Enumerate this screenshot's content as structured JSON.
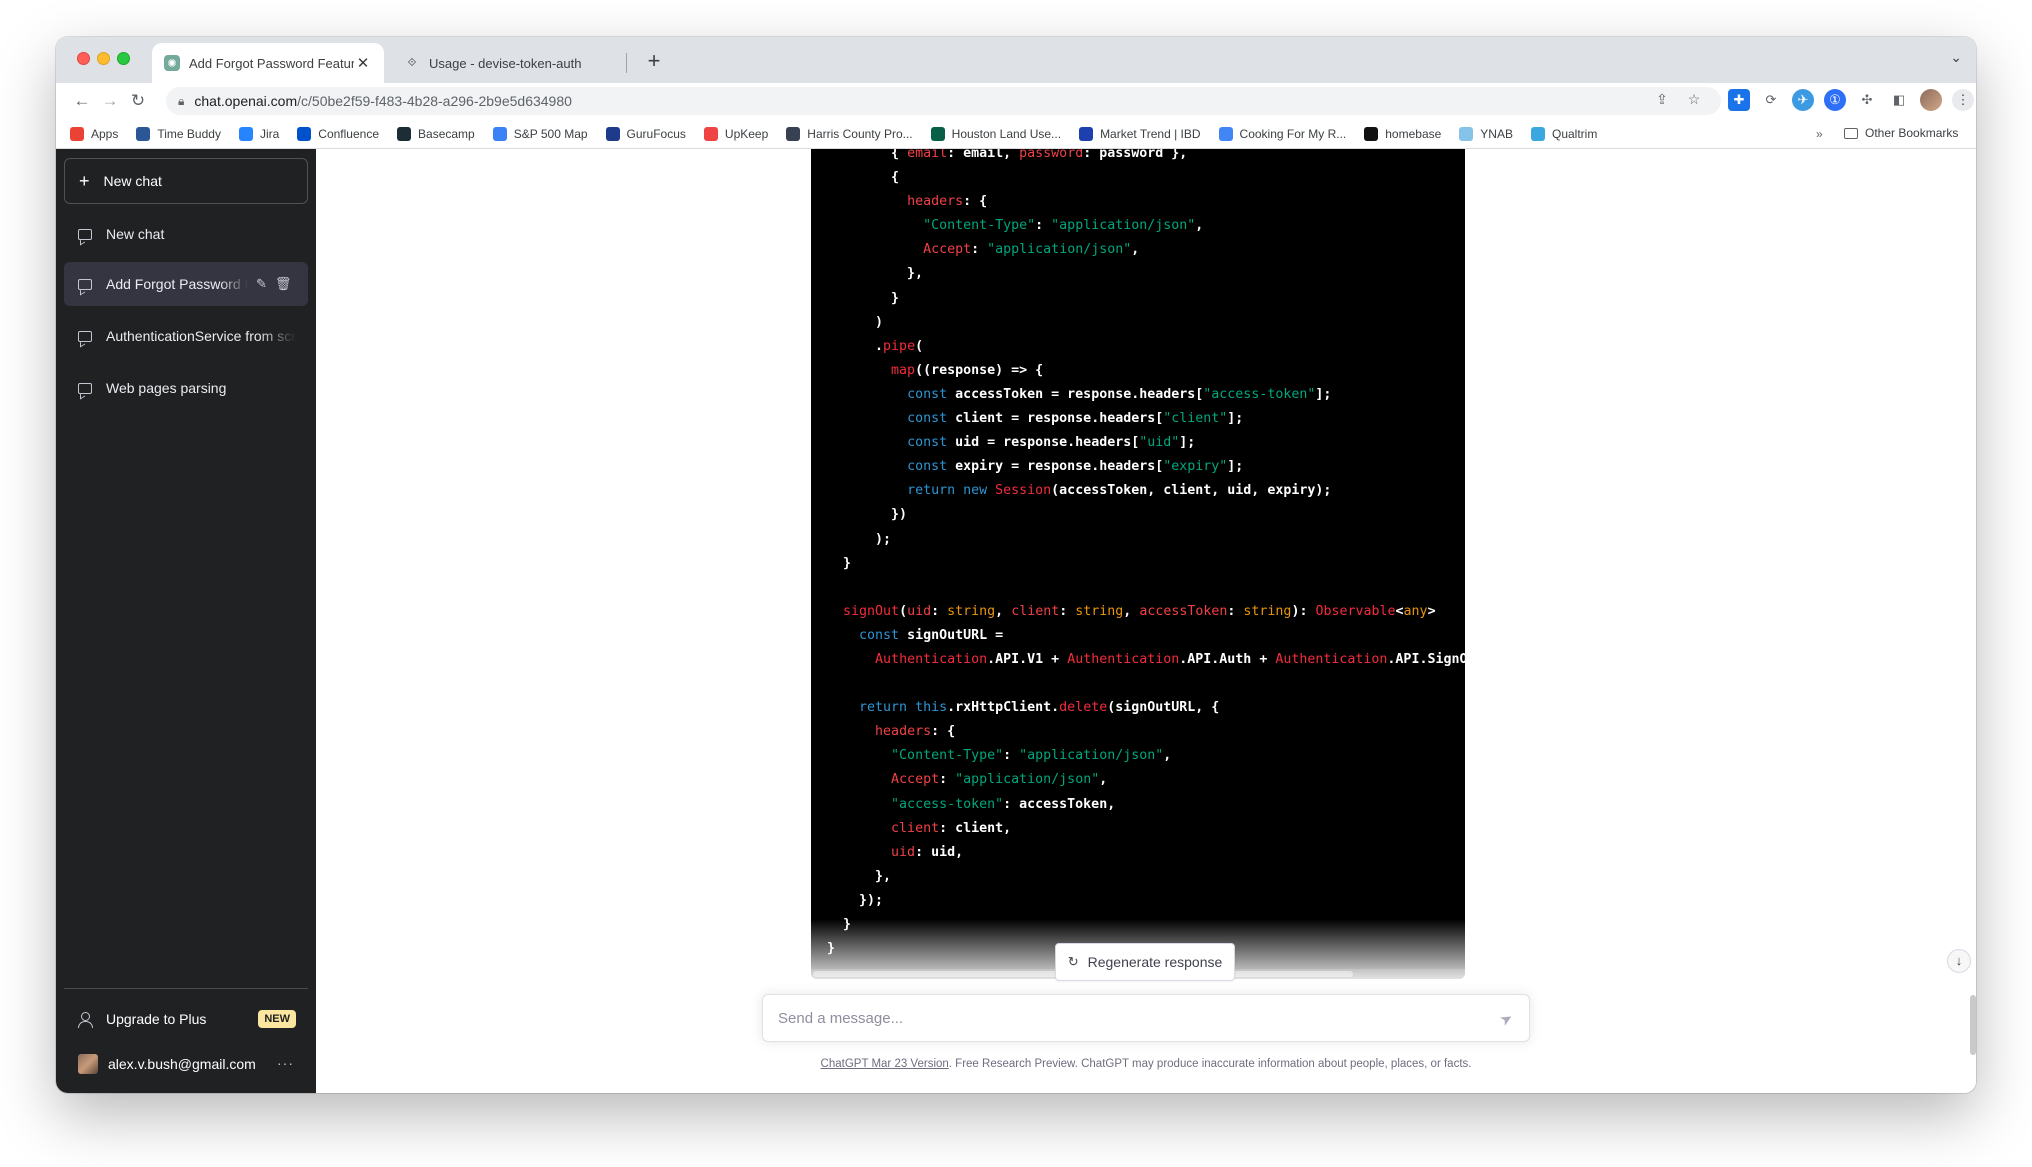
{
  "browser": {
    "tabs": [
      {
        "title": "Add Forgot Password Feature & ...",
        "favicon": "openai-logo-icon",
        "active": true
      },
      {
        "title": "Usage - devise-token-auth",
        "favicon": "devise-icon",
        "active": false
      }
    ],
    "url_host": "chat.openai.com",
    "url_path": "/c/50be2f59-f483-4b28-a296-2b9e5d634980",
    "bookmarks": [
      {
        "label": "Apps",
        "icon": "apps-grid-icon",
        "color": "#ea4335"
      },
      {
        "label": "Time Buddy",
        "icon": "time-buddy-icon",
        "color": "#2b5797"
      },
      {
        "label": "Jira",
        "icon": "jira-icon",
        "color": "#2684ff"
      },
      {
        "label": "Confluence",
        "icon": "confluence-icon",
        "color": "#0052cc"
      },
      {
        "label": "Basecamp",
        "icon": "basecamp-icon",
        "color": "#1d2d35"
      },
      {
        "label": "S&P 500 Map",
        "icon": "finviz-icon",
        "color": "#3b82f6"
      },
      {
        "label": "GuruFocus",
        "icon": "gurufocus-icon",
        "color": "#1e3a8a"
      },
      {
        "label": "UpKeep",
        "icon": "upkeep-icon",
        "color": "#ef4444"
      },
      {
        "label": "Harris County Pro...",
        "icon": "harris-county-icon",
        "color": "#374151"
      },
      {
        "label": "Houston Land Use...",
        "icon": "houston-icon",
        "color": "#065f46"
      },
      {
        "label": "Market Trend | IBD",
        "icon": "ibd-icon",
        "color": "#1e40af"
      },
      {
        "label": "Cooking For My R...",
        "icon": "google-icon",
        "color": "#4285f4"
      },
      {
        "label": "homebase",
        "icon": "github-icon",
        "color": "#111111"
      },
      {
        "label": "YNAB",
        "icon": "ynab-icon",
        "color": "#85c3e9"
      },
      {
        "label": "Qualtrim",
        "icon": "qualtrim-icon",
        "color": "#3ba7e0"
      }
    ],
    "bookmarks_more": "»",
    "other_bookmarks": "Other Bookmarks"
  },
  "sidebar": {
    "new_chat_button": "New chat",
    "conversations": [
      {
        "label": "New chat",
        "selected": false
      },
      {
        "label": "Add Forgot Password Feature & ...",
        "selected": true
      },
      {
        "label": "AuthenticationService from scratch",
        "selected": false
      },
      {
        "label": "Web pages parsing",
        "selected": false
      }
    ],
    "upgrade_label": "Upgrade to Plus",
    "upgrade_badge": "NEW",
    "user_email": "alex.v.bush@gmail.com",
    "more_menu": "···"
  },
  "code_lines": [
    [
      [
        "w",
        "        { "
      ],
      [
        "k",
        "email"
      ],
      [
        "w",
        ": email, "
      ],
      [
        "k",
        "password"
      ],
      [
        "w",
        ": password },"
      ]
    ],
    [
      [
        "w",
        "        {"
      ]
    ],
    [
      [
        "w",
        "          "
      ],
      [
        "k",
        "headers"
      ],
      [
        "w",
        ": {"
      ]
    ],
    [
      [
        "w",
        "            "
      ],
      [
        "s",
        "\"Content-Type\""
      ],
      [
        "w",
        ": "
      ],
      [
        "s",
        "\"application/json\""
      ],
      [
        "w",
        ","
      ]
    ],
    [
      [
        "w",
        "            "
      ],
      [
        "k",
        "Accept"
      ],
      [
        "w",
        ": "
      ],
      [
        "s",
        "\"application/json\""
      ],
      [
        "w",
        ","
      ]
    ],
    [
      [
        "w",
        "          },"
      ]
    ],
    [
      [
        "w",
        "        }"
      ]
    ],
    [
      [
        "w",
        "      )"
      ]
    ],
    [
      [
        "w",
        "      ."
      ],
      [
        "f",
        "pipe"
      ],
      [
        "w",
        "("
      ]
    ],
    [
      [
        "w",
        "        "
      ],
      [
        "f",
        "map"
      ],
      [
        "w",
        "((response) => {"
      ]
    ],
    [
      [
        "w",
        "          "
      ],
      [
        "b",
        "const"
      ],
      [
        "w",
        " accessToken = response.headers["
      ],
      [
        "s",
        "\"access-token\""
      ],
      [
        "w",
        "];"
      ]
    ],
    [
      [
        "w",
        "          "
      ],
      [
        "b",
        "const"
      ],
      [
        "w",
        " client = response.headers["
      ],
      [
        "s",
        "\"client\""
      ],
      [
        "w",
        "];"
      ]
    ],
    [
      [
        "w",
        "          "
      ],
      [
        "b",
        "const"
      ],
      [
        "w",
        " uid = response.headers["
      ],
      [
        "s",
        "\"uid\""
      ],
      [
        "w",
        "];"
      ]
    ],
    [
      [
        "w",
        "          "
      ],
      [
        "b",
        "const"
      ],
      [
        "w",
        " expiry = response.headers["
      ],
      [
        "s",
        "\"expiry\""
      ],
      [
        "w",
        "];"
      ]
    ],
    [
      [
        "w",
        "          "
      ],
      [
        "b",
        "return new "
      ],
      [
        "f",
        "Session"
      ],
      [
        "w",
        "(accessToken, client, uid, expiry);"
      ]
    ],
    [
      [
        "w",
        "        })"
      ]
    ],
    [
      [
        "w",
        "      );"
      ]
    ],
    [
      [
        "w",
        "  }"
      ]
    ],
    [
      [
        "w",
        ""
      ]
    ],
    [
      [
        "w",
        "  "
      ],
      [
        "f",
        "signOut"
      ],
      [
        "w",
        "("
      ],
      [
        "k",
        "uid"
      ],
      [
        "w",
        ": "
      ],
      [
        "t",
        "string"
      ],
      [
        "w",
        ", "
      ],
      [
        "k",
        "client"
      ],
      [
        "w",
        ": "
      ],
      [
        "t",
        "string"
      ],
      [
        "w",
        ", "
      ],
      [
        "k",
        "accessToken"
      ],
      [
        "w",
        ": "
      ],
      [
        "t",
        "string"
      ],
      [
        "w",
        "): "
      ],
      [
        "f",
        "Observable"
      ],
      [
        "w",
        "<"
      ],
      [
        "t",
        "any"
      ],
      [
        "w",
        ">"
      ]
    ],
    [
      [
        "w",
        "    "
      ],
      [
        "b",
        "const"
      ],
      [
        "w",
        " signOutURL ="
      ]
    ],
    [
      [
        "w",
        "      "
      ],
      [
        "f",
        "Authentication"
      ],
      [
        "w",
        ".API.V1 + "
      ],
      [
        "f",
        "Authentication"
      ],
      [
        "w",
        ".API.Auth + "
      ],
      [
        "f",
        "Authentication"
      ],
      [
        "w",
        ".API.SignOut;"
      ]
    ],
    [
      [
        "w",
        ""
      ]
    ],
    [
      [
        "w",
        "    "
      ],
      [
        "b",
        "return this"
      ],
      [
        "w",
        ".rxHttpClient."
      ],
      [
        "f",
        "delete"
      ],
      [
        "w",
        "(signOutURL, {"
      ]
    ],
    [
      [
        "w",
        "      "
      ],
      [
        "k",
        "headers"
      ],
      [
        "w",
        ": {"
      ]
    ],
    [
      [
        "w",
        "        "
      ],
      [
        "s",
        "\"Content-Type\""
      ],
      [
        "w",
        ": "
      ],
      [
        "s",
        "\"application/json\""
      ],
      [
        "w",
        ","
      ]
    ],
    [
      [
        "w",
        "        "
      ],
      [
        "k",
        "Accept"
      ],
      [
        "w",
        ": "
      ],
      [
        "s",
        "\"application/json\""
      ],
      [
        "w",
        ","
      ]
    ],
    [
      [
        "w",
        "        "
      ],
      [
        "s",
        "\"access-token\""
      ],
      [
        "w",
        ": accessToken,"
      ]
    ],
    [
      [
        "w",
        "        "
      ],
      [
        "k",
        "client"
      ],
      [
        "w",
        ": client,"
      ]
    ],
    [
      [
        "w",
        "        "
      ],
      [
        "k",
        "uid"
      ],
      [
        "w",
        ": uid,"
      ]
    ],
    [
      [
        "w",
        "      },"
      ]
    ],
    [
      [
        "w",
        "    });"
      ]
    ],
    [
      [
        "w",
        "  }"
      ]
    ],
    [
      [
        "w",
        "}"
      ]
    ]
  ],
  "main": {
    "regenerate_label": "Regenerate response",
    "composer_placeholder": "Send a message...",
    "footer_link": "ChatGPT Mar 23 Version",
    "footer_text": ". Free Research Preview. ChatGPT may produce inaccurate information about people, places, or facts."
  },
  "colors": {
    "sidebar_bg": "#202123",
    "code_bg": "#000000",
    "code_key": "#ef4146",
    "code_string": "#00a67d",
    "code_keyword": "#2e95d3",
    "code_type": "#e9950c"
  }
}
